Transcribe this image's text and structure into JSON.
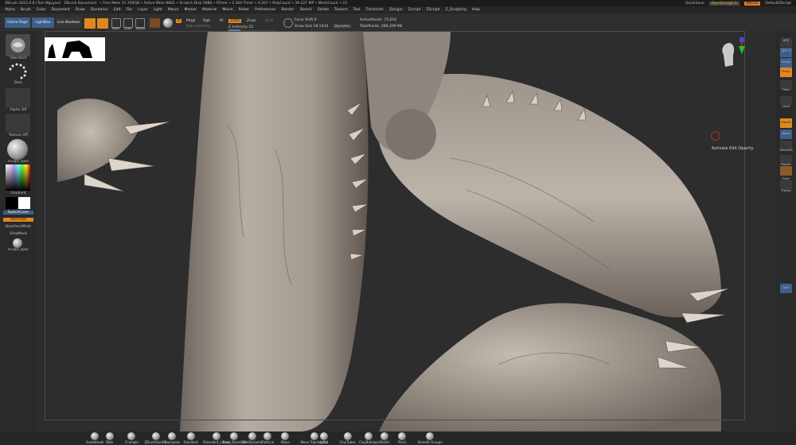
{
  "titlebar": {
    "app": "ZBrush 2022.0.8 [Tom Nguyen]",
    "doc": "ZBrush Document",
    "free_mem": "• Free Mem 31.769GB • Active Mem 9661 • Scratch Disk 5986 • RTime • 0.364 Timer • 0.207 • PolyCount • 39.227 MP • MeshCount • 23",
    "quicksave": "QuickSave",
    "seethrough": "See-through   0",
    "menus": "Menus",
    "script": "DefaultZScript"
  },
  "menubar": {
    "items": [
      "Alpha",
      "Brush",
      "Color",
      "Document",
      "Draw",
      "Dynamics",
      "Edit",
      "File",
      "Layer",
      "Light",
      "Macro",
      "Marker",
      "Material",
      "Movie",
      "Picker",
      "Preferences",
      "Render",
      "Stencil",
      "Stroke",
      "Texture",
      "Tool",
      "Transform",
      "Zplugin",
      "Zscript",
      "ZSculpt",
      "Z_Sculpting",
      "Help"
    ]
  },
  "shelf": {
    "home": "Home Page",
    "lightbox": "LightBox",
    "live_boolean": "Live Boolean",
    "edit": "Edit",
    "draw": "Draw",
    "move": "Move",
    "scale": "Scale",
    "rotate": "Rotate",
    "a": "A",
    "mrgb": "Mrgb",
    "rgb": "Rgb",
    "m": "M",
    "rgb_intensity": "Rgb Intensity",
    "zadd": "Zadd",
    "zsub": "Zsub",
    "zcut": "Zcut",
    "z_intensity": "Z Intensity 25",
    "focal_shift": "Focal Shift 0",
    "draw_size": "Draw Size 58.5424",
    "dynamic": "Dynamic",
    "active_points": "ActivePoints: 75,616",
    "total_points": "TotalPoints: 280,209 Mil"
  },
  "left": {
    "standard": "Standard",
    "dots": "Dots",
    "alpha_off": "Alpha Off",
    "texture_off": "Texture Off",
    "material": "sculpt_spec",
    "gradient": "Gradient",
    "switch_color": "SwitchColor",
    "alternate": "Alternate",
    "backface": "BackfaceMask",
    "viewmask": "ViewMask",
    "sculpt_spec2": "sculpt_spec"
  },
  "viewport": {
    "activate_edit": "Activate Edit Opacity"
  },
  "right": {
    "bpr": "BPR",
    "spix": "SPix 3",
    "actual": "Actual",
    "persp": "Persp",
    "floor": "Floor",
    "local": "Local",
    "frame": "Frame",
    "move": "Move",
    "zoom3d": "Zoom3D",
    "rotate": "Rotate",
    "polyf": "PolyF",
    "transp": "Transp",
    "solo": "Solo"
  },
  "bottom": {
    "brushes": [
      "SnakeHook",
      "Blob",
      "Crumple",
      "ZBrushGuides",
      "Transpose",
      "Standard",
      "IStandard_crease",
      "Dam_Standard",
      "TrimDynamic",
      "FlatLine",
      "Move",
      "Move Topological",
      "Inflat",
      "ClayTubes",
      "ClayBuildup",
      "hPolish",
      "Pinch",
      "Smooth Groups"
    ]
  },
  "colors": {
    "accent": "#e0891f",
    "blue": "#3e5f8a",
    "bg": "#2b2b2b",
    "clay": "#a39a90"
  }
}
